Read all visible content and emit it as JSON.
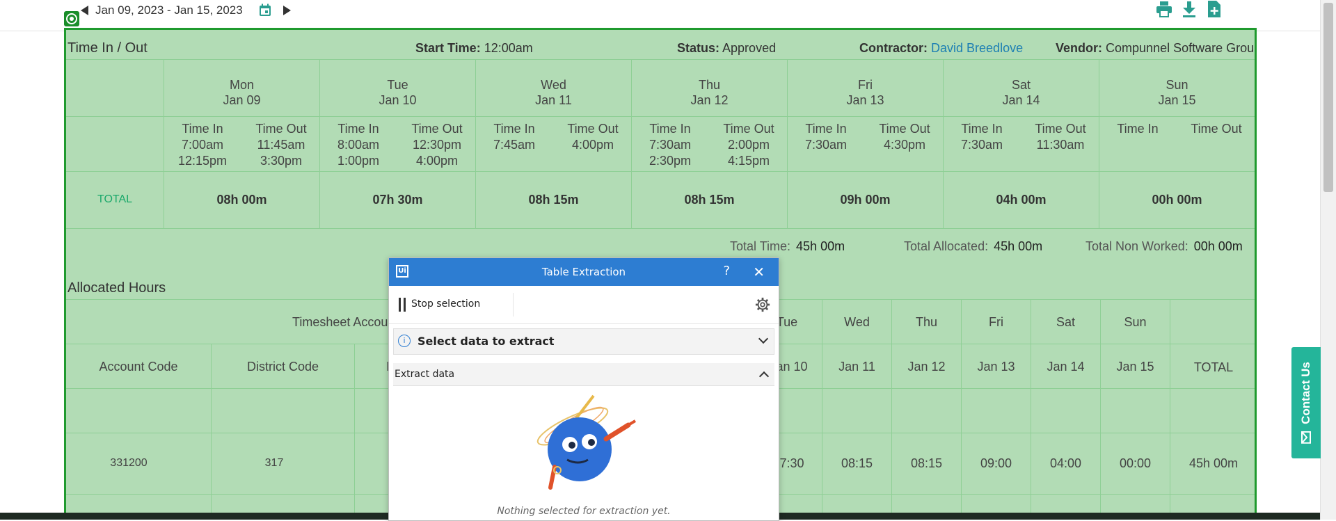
{
  "toolbar": {
    "date_range": "Jan 09, 2023 - Jan 15, 2023",
    "icons": [
      "prev-arrow-icon",
      "calendar-icon",
      "next-arrow-icon",
      "print-icon",
      "download-icon",
      "add-file-icon"
    ],
    "accent_color": "#2a9d8f"
  },
  "timesheet": {
    "section_title": "Time In / Out",
    "start_time_label": "Start Time:",
    "start_time": "12:00am",
    "status_label": "Status:",
    "status": "Approved",
    "contractor_label": "Contractor:",
    "contractor": "David Breedlove",
    "vendor_label": "Vendor:",
    "vendor": "Compunnel Software Group",
    "days": [
      {
        "day": "Mon",
        "date": "Jan 09",
        "time_in": "Time In",
        "time_out": "Time Out",
        "ins": [
          "7:00am",
          "12:15pm"
        ],
        "outs": [
          "11:45am",
          "3:30pm"
        ],
        "total": "08h 00m"
      },
      {
        "day": "Tue",
        "date": "Jan 10",
        "time_in": "Time In",
        "time_out": "Time Out",
        "ins": [
          "8:00am",
          "1:00pm"
        ],
        "outs": [
          "12:30pm",
          "4:00pm"
        ],
        "total": "07h 30m"
      },
      {
        "day": "Wed",
        "date": "Jan 11",
        "time_in": "Time In",
        "time_out": "Time Out",
        "ins": [
          "7:45am",
          ""
        ],
        "outs": [
          "4:00pm",
          ""
        ],
        "total": "08h 15m"
      },
      {
        "day": "Thu",
        "date": "Jan 12",
        "time_in": "Time In",
        "time_out": "Time Out",
        "ins": [
          "7:30am",
          "2:30pm"
        ],
        "outs": [
          "2:00pm",
          "4:15pm"
        ],
        "total": "08h 15m"
      },
      {
        "day": "Fri",
        "date": "Jan 13",
        "time_in": "Time In",
        "time_out": "Time Out",
        "ins": [
          "7:30am",
          ""
        ],
        "outs": [
          "4:30pm",
          ""
        ],
        "total": "09h 00m"
      },
      {
        "day": "Sat",
        "date": "Jan 14",
        "time_in": "Time In",
        "time_out": "Time Out",
        "ins": [
          "7:30am",
          ""
        ],
        "outs": [
          "11:30am",
          ""
        ],
        "total": "04h 00m"
      },
      {
        "day": "Sun",
        "date": "Jan 15",
        "time_in": "Time In",
        "time_out": "Time Out",
        "ins": [
          "",
          ""
        ],
        "outs": [
          "",
          ""
        ],
        "total": "00h 00m"
      }
    ],
    "total_label": "TOTAL",
    "total_time_label": "Total Time:",
    "total_time": "45h 00m",
    "total_allocated_label": "Total Allocated:",
    "total_allocated": "45h 00m",
    "total_non_worked_label": "Total Non Worked:",
    "total_non_worked": "00h 00m"
  },
  "allocated": {
    "title": "Allocated Hours",
    "group_header": "Timesheet Accou",
    "col_account_code": "Account Code",
    "col_district_code": "District Code",
    "col_partial": "I",
    "day_names": [
      "Tue",
      "Wed",
      "Thu",
      "Fri",
      "Sat",
      "Sun"
    ],
    "day_dates": [
      "an 10",
      "Jan 11",
      "Jan 12",
      "Jan 13",
      "Jan 14",
      "Jan 15"
    ],
    "total_label": "TOTAL",
    "row": {
      "account_code": "331200",
      "district_code": "317",
      "values": [
        "7:30",
        "08:15",
        "08:15",
        "09:00",
        "04:00",
        "00:00"
      ],
      "total": "45h 00m"
    }
  },
  "contact": {
    "label": "Contact Us"
  },
  "dialog": {
    "title": "Table Extraction",
    "help": "?",
    "close": "✕",
    "logo": "Ui",
    "stop_selection": "Stop selection",
    "select_data": "Select data to extract",
    "extract_data": "Extract data",
    "empty_message": "Nothing selected for extraction yet."
  }
}
